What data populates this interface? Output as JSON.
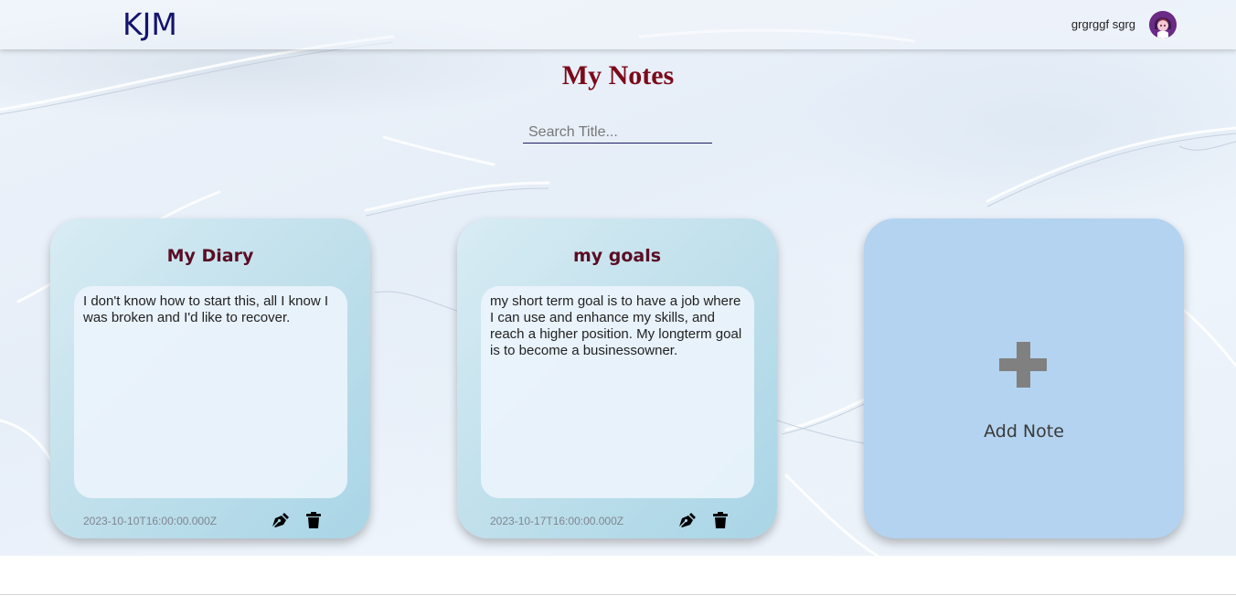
{
  "navbar": {
    "brand": "KJM",
    "username": "grgrggf sgrg"
  },
  "page": {
    "title": "My Notes"
  },
  "search": {
    "placeholder": "Search Title..."
  },
  "notes": [
    {
      "title": "My Diary",
      "content": "I don't know how to start this, all I know I was broken and I'd like to recover.",
      "date": "2023-10-10T16:00:00.000Z"
    },
    {
      "title": "my goals",
      "content": "my short term goal is to have a job where I can use and enhance my skills, and reach a higher position. My longterm goal is to become a businessowner.",
      "date": "2023-10-17T16:00:00.000Z"
    }
  ],
  "add_note": {
    "label": "Add Note"
  },
  "icons": {
    "edit": "pen-nib-icon",
    "delete": "trash-icon",
    "add": "plus-icon"
  },
  "colors": {
    "brand": "#14136e",
    "title": "#7b0a1a",
    "card_title": "#5a0d24",
    "add_card": "#b3d3f0"
  }
}
